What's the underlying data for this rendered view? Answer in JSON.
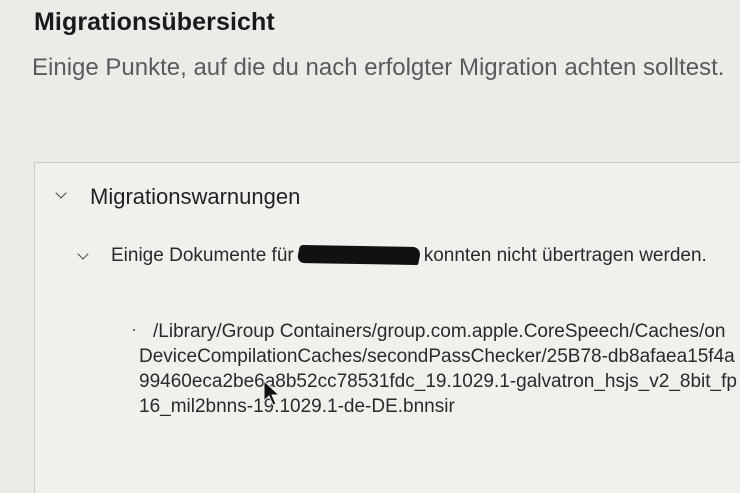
{
  "page": {
    "title": "Migrationsübersicht",
    "subtitle": "Einige Punkte, auf die du nach erfolgter Migration achten solltest."
  },
  "warnings_section": {
    "title": "Migrationswarnungen",
    "expanded": true,
    "icon": "chevron-down-icon",
    "items": [
      {
        "text_before": "Einige Dokumente für",
        "text_after": "konnten nicht übertragen werden.",
        "expanded": true,
        "files": [
          "/Library/Group Containers/group.com.apple.CoreSpeech/Caches/onDeviceCompilationCaches/secondPassChecker/25B78-db8afaea15f4a99460eca2be6a8b52cc78531fdc_19.1029.1-galvatron_hsjs_v2_8bit_fp16_mil2bnns-19.1029.1-de-DE.bnnsir"
        ]
      }
    ]
  },
  "colors": {
    "background": "#ebebe8",
    "title": "#1a1a1a",
    "subtitle": "#5a5a5a",
    "border": "#c9c9c6"
  }
}
